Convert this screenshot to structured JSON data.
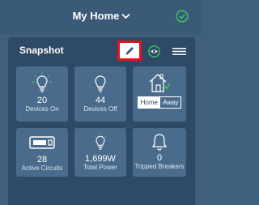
{
  "header": {
    "title": "My Home"
  },
  "panel": {
    "title": "Snapshot"
  },
  "tiles": [
    {
      "value": "20",
      "label": "Devices On"
    },
    {
      "value": "44",
      "label": "Devices Off"
    },
    {
      "mode_home": "Home",
      "mode_away": "Away",
      "selected": "Home"
    },
    {
      "value": "28",
      "label": "Active Circuits"
    },
    {
      "value": "1,699W",
      "label": "Total Power"
    },
    {
      "value": "0",
      "label": "Tripped Breakers"
    }
  ],
  "colors": {
    "background": "#3f5f7d",
    "panel": "#2e4a66",
    "tile": "#4a6b8c",
    "accent_green": "#3ec15f",
    "highlight_red": "#e0141b"
  },
  "icons": [
    "chevron-down-icon",
    "check-circle-icon",
    "pencil-icon",
    "eye-icon",
    "menu-icon",
    "lightbulb-on-icon",
    "lightbulb-off-icon",
    "home-icon",
    "circuit-icon",
    "bell-icon"
  ]
}
